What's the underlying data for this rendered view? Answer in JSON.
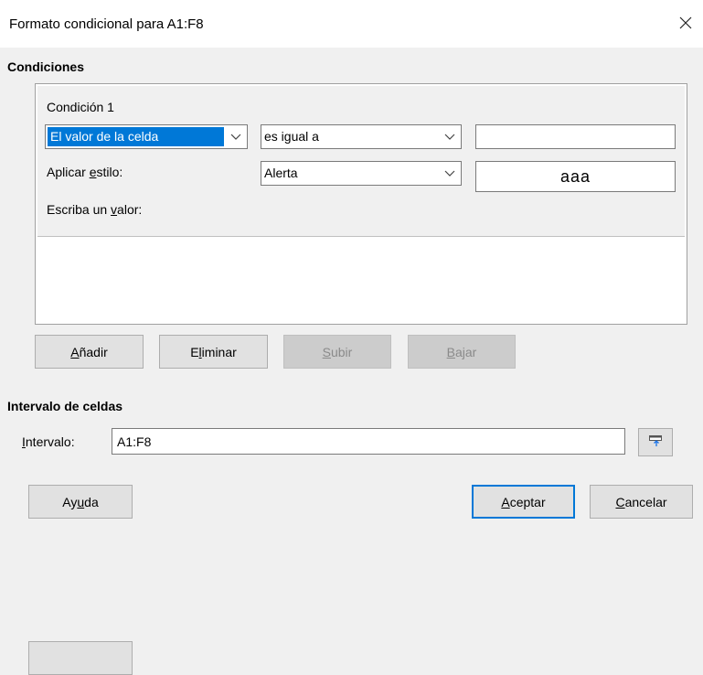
{
  "window": {
    "title": "Formato condicional para A1:F8"
  },
  "conditions": {
    "heading": "Condiciones",
    "entry": {
      "label": "Condición 1",
      "type_value": "El valor de la celda",
      "operator_value": "es igual a",
      "value_input": "",
      "apply_style_label": {
        "pre": "Aplicar ",
        "key": "e",
        "post": "stilo:"
      },
      "style_value": "Alerta",
      "preview_text": "aaa",
      "enter_value_label": {
        "pre": "Escriba un ",
        "key": "v",
        "post": "alor:"
      }
    },
    "buttons": {
      "add": {
        "pre": "",
        "key": "A",
        "post": "ñadir"
      },
      "remove": {
        "pre": "E",
        "key": "l",
        "post": "iminar"
      },
      "up": {
        "pre": "",
        "key": "S",
        "post": "ubir"
      },
      "down": {
        "pre": "",
        "key": "B",
        "post": "ajar"
      }
    }
  },
  "cell_range": {
    "heading": "Intervalo de celdas",
    "label": {
      "pre": "",
      "key": "I",
      "post": "ntervalo:"
    },
    "value": "A1:F8"
  },
  "footer": {
    "help": {
      "pre": "Ay",
      "key": "u",
      "post": "da"
    },
    "ok": {
      "pre": "",
      "key": "A",
      "post": "ceptar"
    },
    "cancel": {
      "pre": "",
      "key": "C",
      "post": "ancelar"
    }
  },
  "colors": {
    "selection": "#0078d7",
    "dialog_bg": "#f0f0f0"
  },
  "icons": [
    "close-icon",
    "chevron-down-icon",
    "shrink-dialog-icon"
  ]
}
